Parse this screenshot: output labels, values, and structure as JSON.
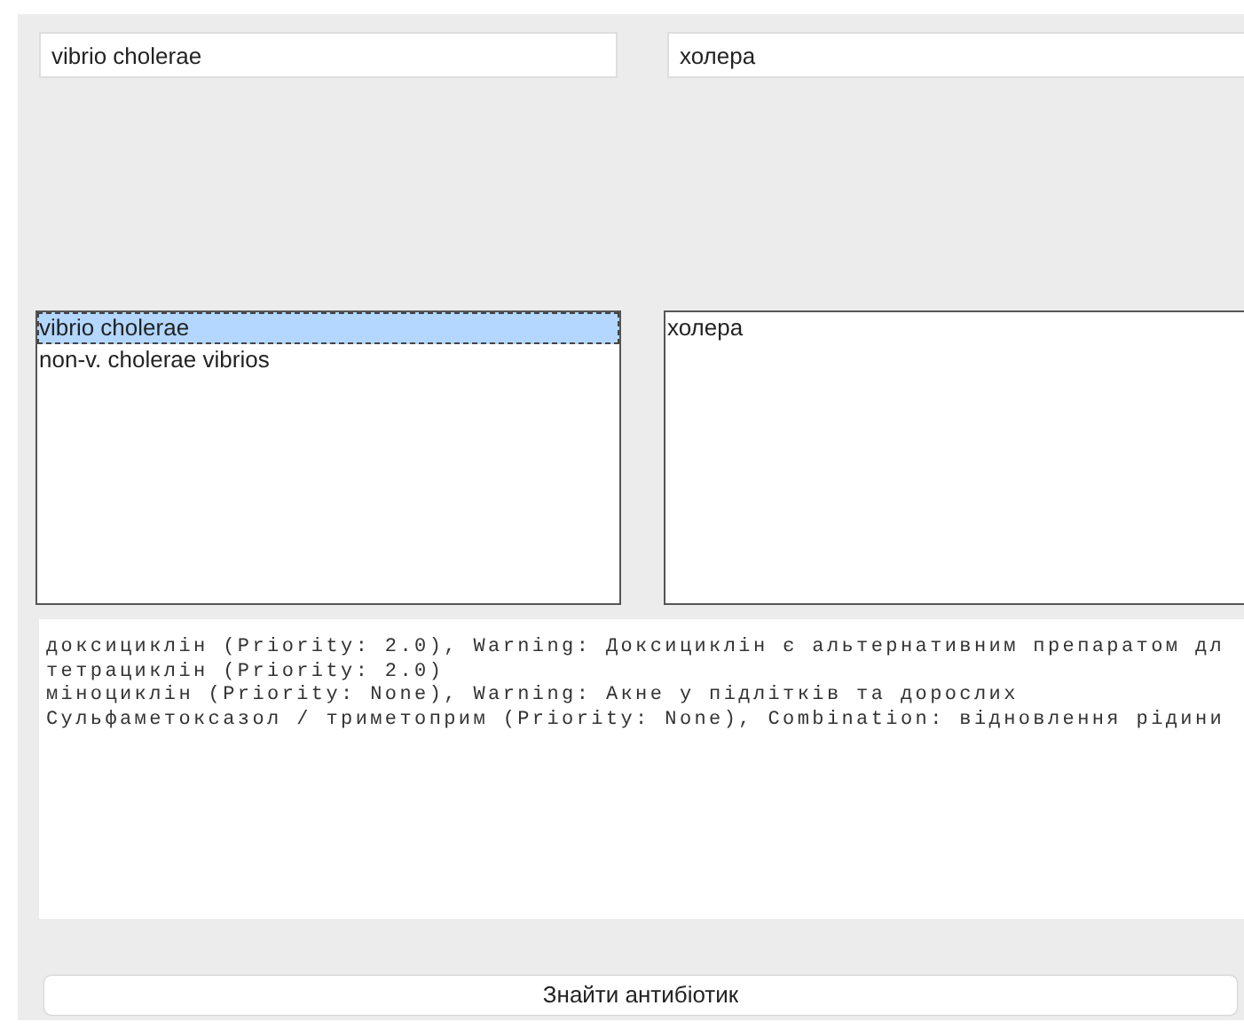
{
  "search_fields": [
    {
      "value": "vibrio cholerae"
    },
    {
      "value": "холера"
    }
  ],
  "bacteria_list": {
    "items": [
      {
        "label": "vibrio cholerae",
        "selected": true
      },
      {
        "label": "non-v. cholerae vibrios",
        "selected": false
      }
    ]
  },
  "disease_list": {
    "items": [
      {
        "label": "холера",
        "selected": false
      }
    ]
  },
  "results": {
    "lines": [
      "доксициклін (Priority: 2.0), Warning: Доксициклін є альтернативним препаратом дл",
      "тетрациклін (Priority: 2.0)",
      "міноциклін (Priority: None), Warning: Акне у підлітків та дорослих",
      "Сульфаметоксазол / триметоприм (Priority: None), Combination: відновлення рідини"
    ]
  },
  "find_button": {
    "label": "Знайти антибіотик"
  }
}
